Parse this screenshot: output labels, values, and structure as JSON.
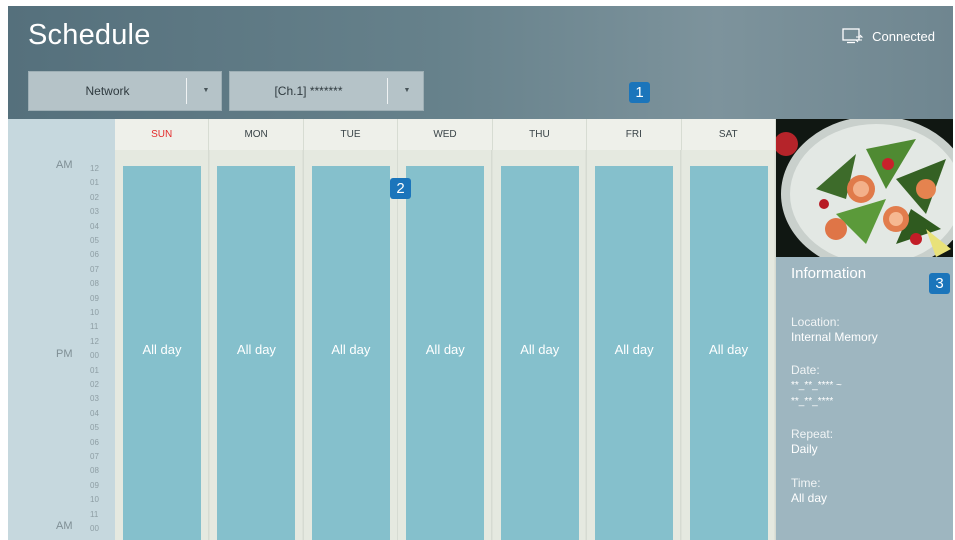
{
  "header": {
    "title": "Schedule",
    "connection_status": "Connected"
  },
  "filters": {
    "source": "Network",
    "channel": "[Ch.1] *******"
  },
  "badges": [
    "1",
    "2",
    "3"
  ],
  "time_column": {
    "am_label": "AM",
    "pm_label": "PM",
    "am_end_label": "AM",
    "hours": [
      "12",
      "01",
      "02",
      "03",
      "04",
      "05",
      "06",
      "07",
      "08",
      "09",
      "10",
      "11",
      "12",
      "00",
      "01",
      "02",
      "03",
      "04",
      "05",
      "06",
      "07",
      "08",
      "09",
      "10",
      "11",
      "00"
    ]
  },
  "calendar": {
    "days": [
      "SUN",
      "MON",
      "TUE",
      "WED",
      "THU",
      "FRI",
      "SAT"
    ],
    "event_label": "All day",
    "sunday_color": "#e32b2b",
    "event_color": "#85c0cc"
  },
  "info_panel": {
    "title": "Information",
    "location_label": "Location:",
    "location_value": "Internal Memory",
    "date_label": "Date:",
    "date_start": "**_**_**** ~",
    "date_end": "**_**_****",
    "repeat_label": "Repeat:",
    "repeat_value": "Daily",
    "time_label": "Time:",
    "time_value": "All day"
  }
}
